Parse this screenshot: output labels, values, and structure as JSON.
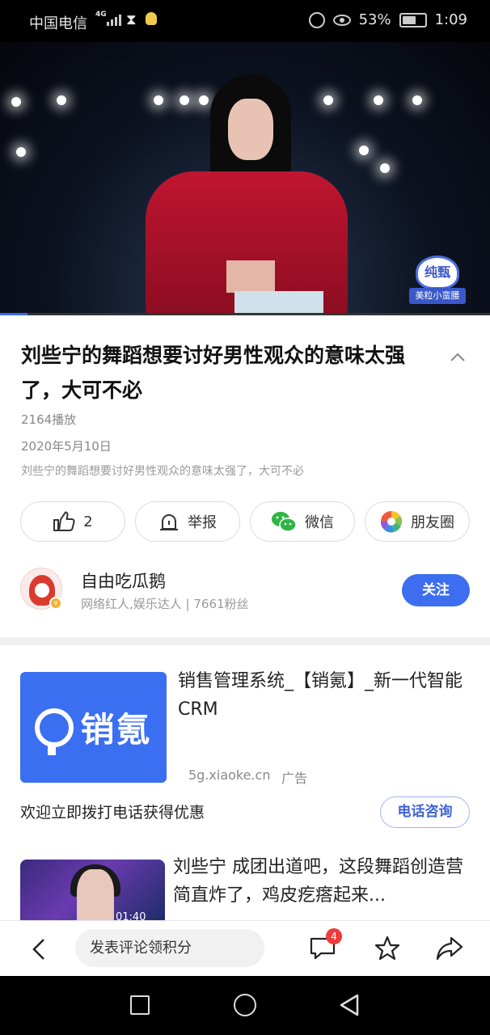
{
  "status_bar": {
    "carrier": "中国电信",
    "network": "4G",
    "battery": "53%",
    "time": "1:09"
  },
  "video": {
    "watermark_brand": "纯甄",
    "watermark_sub": "美粒小蛮腰",
    "progress_fraction": 0.056
  },
  "article": {
    "title": "刘些宁的舞蹈想要讨好男性观众的意味太强了，大可不必",
    "plays": "2164播放",
    "date": "2020年5月10日",
    "description": "刘些宁的舞蹈想要讨好男性观众的意味太强了，大可不必"
  },
  "actions": {
    "like_count": "2",
    "report_label": "举报",
    "wechat_label": "微信",
    "moments_label": "朋友圈"
  },
  "author": {
    "name": "自由吃瓜鹅",
    "meta": "网络红人,娱乐达人 | 7661粉丝",
    "follow_label": "关注"
  },
  "ad": {
    "logo_text": "销氪",
    "title": "销售管理系统_【销氪】_新一代智能CRM",
    "domain": "5g.xiaoke.cn",
    "tag": "广告",
    "cta_text": "欢迎立即拨打电话获得优惠",
    "cta_button": "电话咨询"
  },
  "related": {
    "title": "刘些宁 成团出道吧，这段舞蹈创造营简直炸了，鸡皮疙瘩起来...",
    "duration": "01:40"
  },
  "bottom_bar": {
    "comment_placeholder": "发表评论领积分",
    "comment_count": "4"
  },
  "colors": {
    "accent": "#3d6ef0",
    "badge": "#ee3b3b"
  }
}
